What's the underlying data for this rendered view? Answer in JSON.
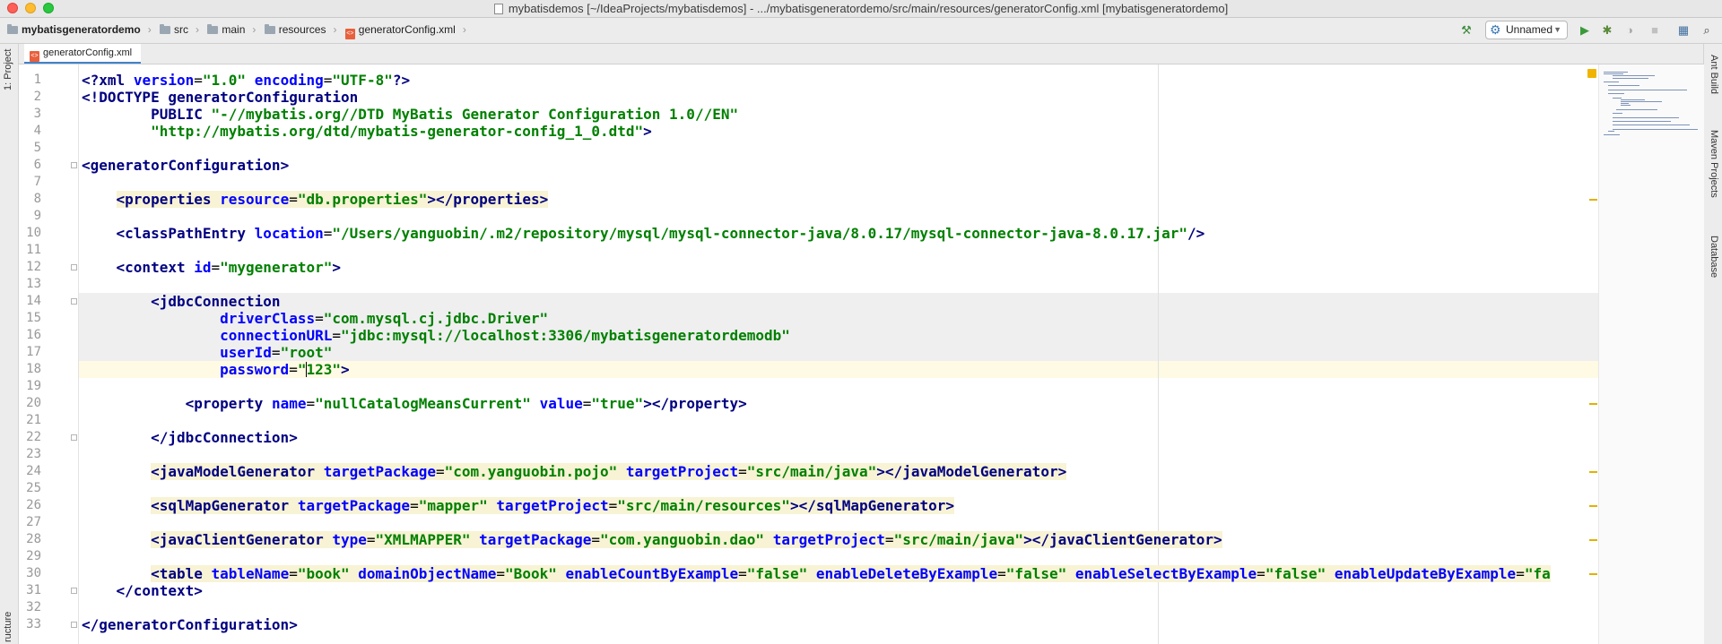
{
  "window": {
    "title": "mybatisdemos [~/IdeaProjects/mybatisdemos] - .../mybatisgeneratordemo/src/main/resources/generatorConfig.xml [mybatisgeneratordemo]"
  },
  "breadcrumb": [
    {
      "label": "mybatisgeneratordemo",
      "bold": true,
      "icon": "folder-icon"
    },
    {
      "label": "src",
      "icon": "folder-icon"
    },
    {
      "label": "main",
      "icon": "folder-icon"
    },
    {
      "label": "resources",
      "icon": "folder-icon"
    },
    {
      "label": "generatorConfig.xml",
      "icon": "xml-file-icon"
    }
  ],
  "toolbar": {
    "run_config": "Unnamed",
    "icons": [
      "build-hammer-icon",
      "run-icon",
      "debug-icon",
      "coverage-icon",
      "stop-icon",
      "project-structure-icon",
      "search-icon"
    ]
  },
  "left_stripe": {
    "project": "1: Project",
    "structure": "ructure"
  },
  "right_stripe": {
    "ant": "Ant Build",
    "maven": "Maven Projects",
    "database": "Database"
  },
  "editor": {
    "tab_label": "generatorConfig.xml",
    "lines": [
      "<?xml version=\"1.0\" encoding=\"UTF-8\"?>",
      "<!DOCTYPE generatorConfiguration",
      "        PUBLIC \"-//mybatis.org//DTD MyBatis Generator Configuration 1.0//EN\"",
      "        \"http://mybatis.org/dtd/mybatis-generator-config_1_0.dtd\">",
      "",
      "<generatorConfiguration>",
      "",
      "    <properties resource=\"db.properties\"></properties>",
      "",
      "    <classPathEntry location=\"/Users/yanguobin/.m2/repository/mysql/mysql-connector-java/8.0.17/mysql-connector-java-8.0.17.jar\"/>",
      "",
      "    <context id=\"mygenerator\">",
      "",
      "        <jdbcConnection",
      "                driverClass=\"com.mysql.cj.jdbc.Driver\"",
      "                connectionURL=\"jdbc:mysql://localhost:3306/mybatisgeneratordemodb\"",
      "                userId=\"root\"",
      "                password=\"123\">",
      "",
      "            <property name=\"nullCatalogMeansCurrent\" value=\"true\"></property>",
      "",
      "        </jdbcConnection>",
      "",
      "        <javaModelGenerator targetPackage=\"com.yanguobin.pojo\" targetProject=\"src/main/java\"></javaModelGenerator>",
      "",
      "        <sqlMapGenerator targetPackage=\"mapper\" targetProject=\"src/main/resources\"></sqlMapGenerator>",
      "",
      "        <javaClientGenerator type=\"XMLMAPPER\" targetPackage=\"com.yanguobin.dao\" targetProject=\"src/main/java\"></javaClientGenerator>",
      "",
      "        <table tableName=\"book\" domainObjectName=\"Book\" enableCountByExample=\"false\" enableDeleteByExample=\"false\" enableSelectByExample=\"false\" enableUpdateByExample=\"fa",
      "    </context>",
      "",
      "</generatorConfiguration>"
    ],
    "caret": {
      "line": 18,
      "column": 26
    }
  }
}
